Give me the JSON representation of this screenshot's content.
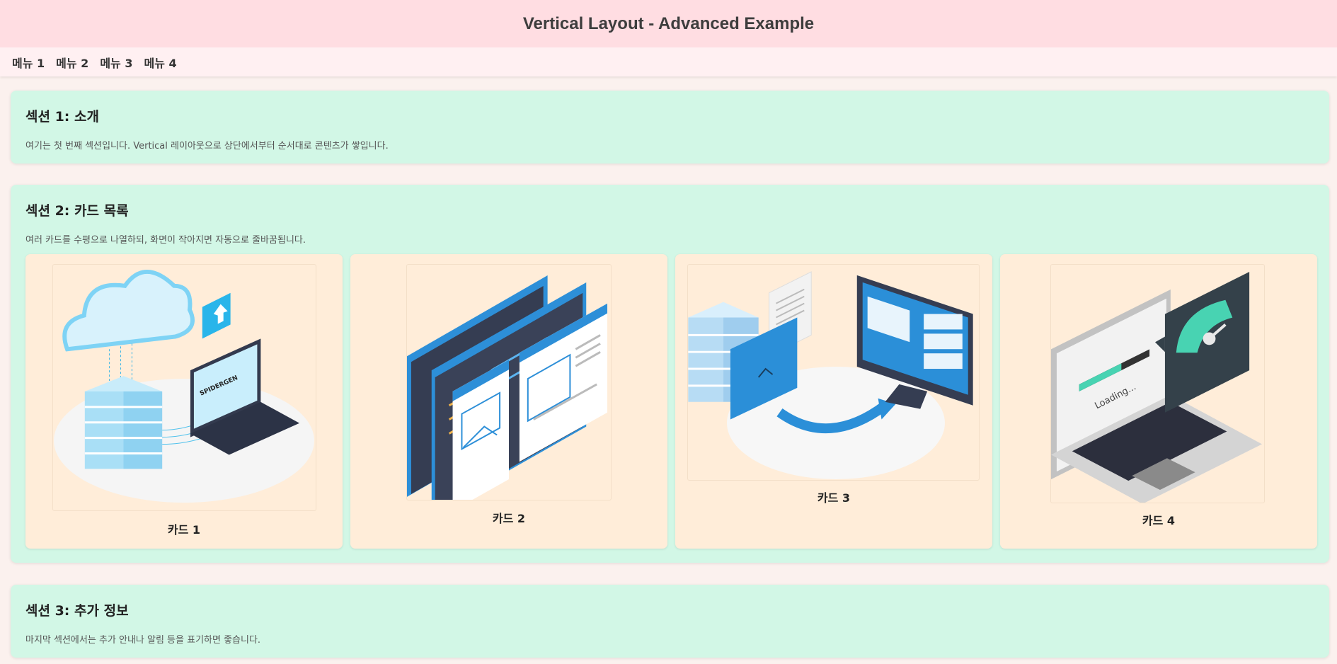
{
  "header": {
    "title": "Vertical Layout - Advanced Example"
  },
  "nav": {
    "items": [
      "메뉴 1",
      "메뉴 2",
      "메뉴 3",
      "메뉴 4"
    ]
  },
  "sections": [
    {
      "title": "섹션 1: 소개",
      "text": "여기는 첫 번째 섹션입니다. Vertical 레이아웃으로 상단에서부터 순서대로 콘텐츠가 쌓입니다."
    },
    {
      "title": "섹션 2: 카드 목록",
      "text": "여러 카드를 수평으로 나열하되, 화면이 작아지면 자동으로 줄바꿈됩니다."
    },
    {
      "title": "섹션 3: 추가 정보",
      "text": "마지막 섹션에서는 추가 안내나 알림 등을 표기하면 좋습니다."
    }
  ],
  "cards": [
    {
      "label": "카드 1",
      "image": "cloud-server-laptop-illustration",
      "image_text": "SPIDERGEN"
    },
    {
      "label": "카드 2",
      "image": "code-editor-windows-illustration"
    },
    {
      "label": "카드 3",
      "image": "file-transfer-server-monitor-illustration"
    },
    {
      "label": "카드 4",
      "image": "laptop-loading-speed-gauge-illustration",
      "image_text": "Loading..."
    }
  ],
  "colors": {
    "header_bg": "#ffdde2",
    "nav_bg": "#fff0f2",
    "page_bg": "#fbf1ee",
    "section_bg": "#d2f7e6",
    "card_bg": "#ffedd9",
    "illustration_accent": "#2b8fd8"
  }
}
